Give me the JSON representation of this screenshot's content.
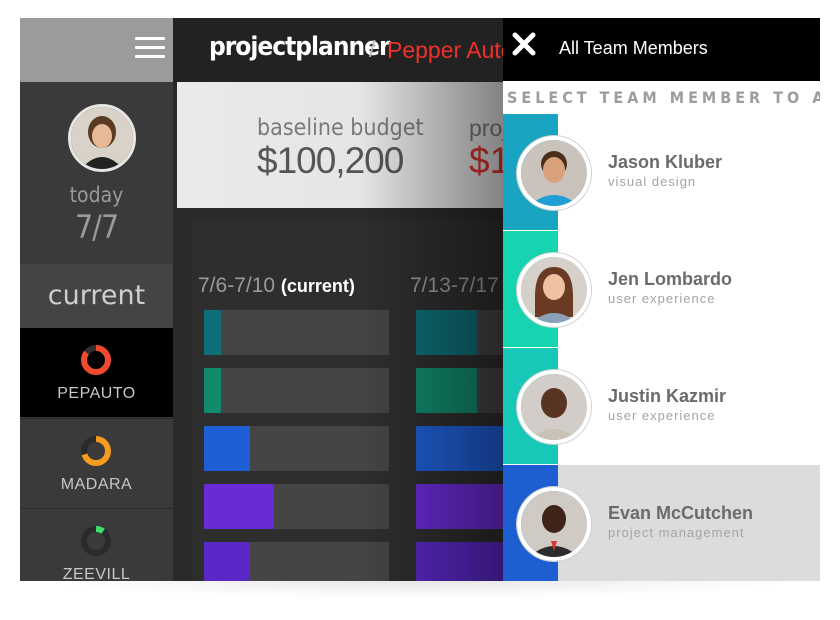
{
  "header": {
    "brand": "projectplanner",
    "separator": "/",
    "project": "Pepper Auto"
  },
  "sidebar": {
    "today_label": "today",
    "today_date": "7/7",
    "current_heading": "current",
    "projects": [
      {
        "name": "PEPAUTO",
        "ring_color": "#f04a2c",
        "progress": 0.85,
        "active": true
      },
      {
        "name": "MADARA",
        "ring_color": "#f49b20",
        "progress": 0.7,
        "active": false
      },
      {
        "name": "ZEEVILL",
        "ring_color": "#3ee06a",
        "progress": 0.1,
        "active": false
      }
    ]
  },
  "budget": {
    "baseline_label": "baseline budget",
    "baseline_value": "$100,200",
    "projected_label": "proj",
    "projected_value": "$1"
  },
  "timeline": {
    "week1_range": "7/6-7/10",
    "week1_current": "(current)",
    "week2_range": "7/13-7/17",
    "bars": [
      {
        "color": "#0f6f78",
        "week1_fill": 0.09,
        "week2_fill": 0.33
      },
      {
        "color": "#118a6e",
        "week1_fill": 0.09,
        "week2_fill": 0.33
      },
      {
        "color": "#1e5fd6",
        "week1_fill": 0.25,
        "week2_fill": 0.5
      },
      {
        "color": "#6a2bd6",
        "week1_fill": 0.38,
        "week2_fill": 0.8
      },
      {
        "color": "#5a28c8",
        "week1_fill": 0.25,
        "week2_fill": 0.8
      }
    ]
  },
  "drawer": {
    "title": "All Team Members",
    "select_label": "SELECT TEAM MEMBER TO ADD",
    "members": [
      {
        "name": "Jason Kluber",
        "role": "visual design",
        "stripe": "#19a4c2",
        "selected": false
      },
      {
        "name": "Jen Lombardo",
        "role": "user experience",
        "stripe": "#17d4b0",
        "selected": false
      },
      {
        "name": "Justin Kazmir",
        "role": "user experience",
        "stripe": "#17c8b8",
        "selected": false
      },
      {
        "name": "Evan McCutchen",
        "role": "project management",
        "stripe": "#1d5fd0",
        "selected": true
      }
    ]
  }
}
